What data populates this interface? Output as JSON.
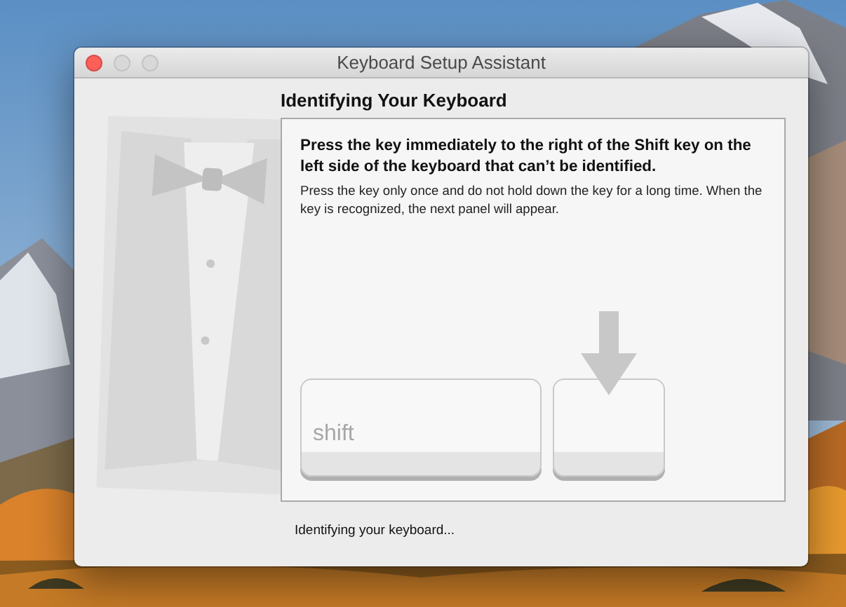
{
  "window": {
    "title": "Keyboard Setup Assistant",
    "controls": [
      {
        "kind": "close",
        "disabled": false
      },
      {
        "kind": "minimize",
        "disabled": true
      },
      {
        "kind": "zoom",
        "disabled": true
      }
    ]
  },
  "heading": "Identifying Your Keyboard",
  "instruction": "Press the key immediately to the right of the Shift key on the left side of the keyboard that can’t be identified.",
  "hint": "Press the key only once and do not hold down the key for a long time. When the key is recognized, the next panel will appear.",
  "keys": [
    {
      "label": "shift",
      "target": false
    },
    {
      "target": true
    }
  ],
  "status": "Identifying your keyboard..."
}
